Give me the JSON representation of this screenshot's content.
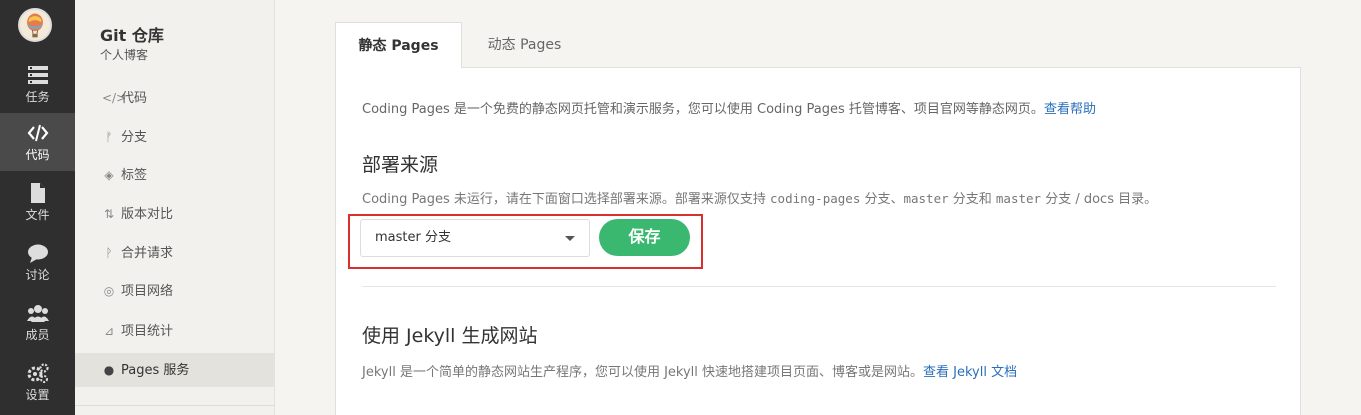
{
  "rail": {
    "items": [
      {
        "label": "任务",
        "icon": "tasks-icon"
      },
      {
        "label": "代码",
        "icon": "code-icon",
        "active": true
      },
      {
        "label": "文件",
        "icon": "file-icon"
      },
      {
        "label": "讨论",
        "icon": "chat-icon"
      },
      {
        "label": "成员",
        "icon": "members-icon"
      },
      {
        "label": "设置",
        "icon": "settings-icon"
      }
    ]
  },
  "repo": {
    "title": "Git 仓库",
    "subtitle": "个人博客"
  },
  "subnav": {
    "items": [
      {
        "label": "代码",
        "icon": "code-icon"
      },
      {
        "label": "分支",
        "icon": "branch-icon"
      },
      {
        "label": "标签",
        "icon": "tag-icon"
      },
      {
        "label": "版本对比",
        "icon": "compare-icon"
      },
      {
        "label": "合并请求",
        "icon": "merge-request-icon"
      },
      {
        "label": "项目网络",
        "icon": "network-icon"
      },
      {
        "label": "项目统计",
        "icon": "stats-icon"
      },
      {
        "label": "Pages 服务",
        "icon": "globe-icon",
        "active": true
      }
    ]
  },
  "tabs": [
    {
      "label": "静态 Pages",
      "active": true
    },
    {
      "label": "动态 Pages",
      "active": false
    }
  ],
  "intro": {
    "text": "Coding Pages 是一个免费的静态网页托管和演示服务，您可以使用 Coding Pages 托管博客、项目官网等静态网页。",
    "link": "查看帮助"
  },
  "deploy": {
    "heading": "部署来源",
    "desc_prefix": "Coding Pages 未运行，请在下面窗口选择部署来源。部署来源仅支持 ",
    "code1": "coding-pages",
    "desc_mid1": " 分支、",
    "code2": "master",
    "desc_mid2": " 分支和 ",
    "code3": "master",
    "desc_suffix": " 分支 / docs 目录。",
    "select_value": "master 分支",
    "save_label": "保存"
  },
  "jekyll": {
    "heading": "使用 Jekyll 生成网站",
    "desc": "Jekyll 是一个简单的静态网站生产程序，您可以使用 Jekyll 快速地搭建项目页面、博客或是网站。",
    "link": "查看 Jekyll 文档"
  },
  "colors": {
    "rail_bg": "#2f2f2f",
    "accent_green": "#3ab86f",
    "highlight_red": "#d8302b",
    "link_blue": "#2a6fbb"
  }
}
